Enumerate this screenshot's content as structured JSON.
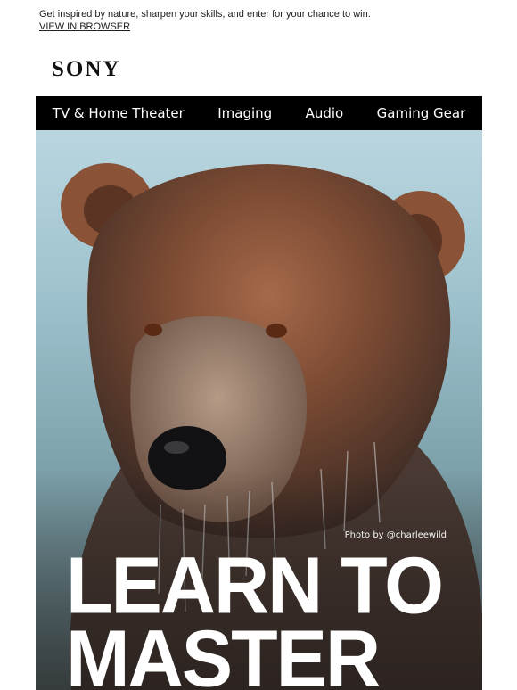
{
  "preheader": {
    "text": "Get inspired by nature, sharpen your skills, and enter for your chance to win.",
    "view_in_browser": "VIEW IN BROWSER"
  },
  "brand": {
    "logo_text": "SONY"
  },
  "nav": {
    "items": [
      "TV & Home Theater",
      "Imaging",
      "Audio",
      "Gaming Gear"
    ]
  },
  "hero": {
    "photo_credit": "Photo by @charleewild",
    "headline_line1": "LEARN TO",
    "headline_line2": "MASTER",
    "image_subject": "brown bear"
  },
  "colors": {
    "nav_bg": "#000000",
    "nav_text": "#ffffff",
    "headline": "#ffffff"
  }
}
